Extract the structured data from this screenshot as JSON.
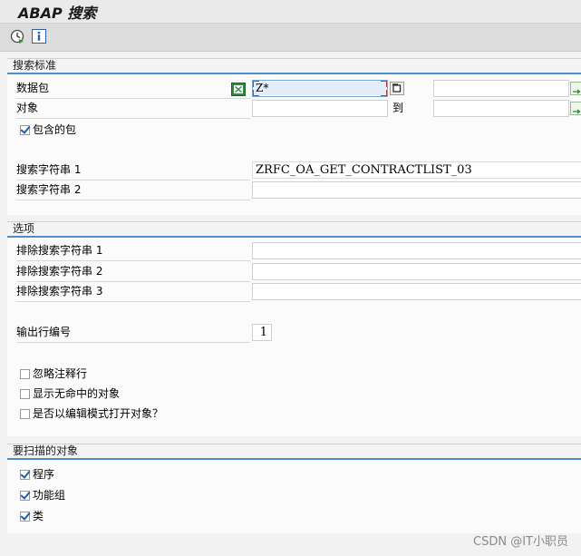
{
  "window": {
    "title": "ABAP 搜索"
  },
  "toolbar": {
    "execute_icon": "execute-clock-icon",
    "info_icon": "info-icon"
  },
  "criteria": {
    "header": "搜索标准",
    "package_label": "数据包",
    "package_value": "Z*",
    "object_label": "对象",
    "object_value": "",
    "to_label": "到",
    "package_to_value": "",
    "object_to_value": "",
    "include_packages_label": "包含的包",
    "include_packages_checked": true,
    "search_string_1_label": "搜索字符串 1",
    "search_string_1_value": "ZRFC_OA_GET_CONTRACTLIST_03",
    "search_string_2_label": "搜索字符串 2",
    "search_string_2_value": ""
  },
  "options": {
    "header": "选项",
    "exclude_1_label": "排除搜索字符串 1",
    "exclude_2_label": "排除搜索字符串 2",
    "exclude_3_label": "排除搜索字符串 3",
    "exclude_1_value": "",
    "exclude_2_value": "",
    "exclude_3_value": "",
    "output_line_label": "输出行编号",
    "output_line_value": "1",
    "ignore_comments_label": "忽略注释行",
    "ignore_comments_checked": false,
    "show_unmatched_label": "显示无命中的对象",
    "show_unmatched_checked": false,
    "edit_mode_label": "是否以编辑模式打开对象？",
    "edit_mode_checked": false
  },
  "scan": {
    "header": "要扫描的对象",
    "programs_label": "程序",
    "programs_checked": true,
    "function_groups_label": "功能组",
    "function_groups_checked": true,
    "classes_label": "类",
    "classes_checked": true
  },
  "watermark": "CSDN @IT小职员",
  "colors": {
    "section_rule": "#4a8fc8",
    "focus_corner": "#c0392b",
    "checkmark": "#1a5fb4"
  }
}
